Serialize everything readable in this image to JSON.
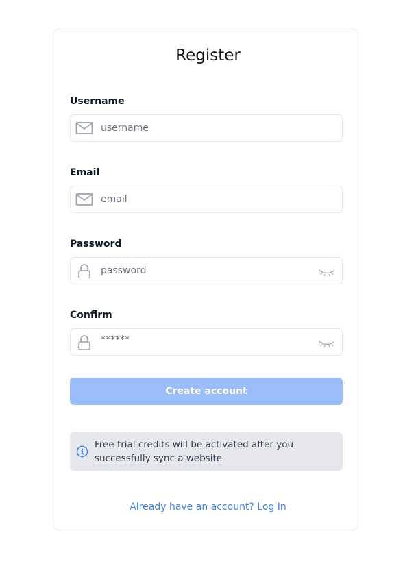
{
  "form": {
    "title": "Register",
    "username": {
      "label": "Username",
      "placeholder": "username",
      "value": "",
      "icon": "mail-icon"
    },
    "email": {
      "label": "Email",
      "placeholder": "email",
      "value": "",
      "icon": "mail-icon"
    },
    "password": {
      "label": "Password",
      "placeholder": "password",
      "value": "",
      "icon": "lock-icon",
      "toggle_icon": "eye-closed-icon"
    },
    "confirm": {
      "label": "Confirm",
      "placeholder": "******",
      "value": "",
      "icon": "lock-icon",
      "toggle_icon": "eye-closed-icon"
    },
    "submit_label": "Create account",
    "notice": {
      "icon": "info-icon",
      "text": "Free trial credits will be activated after you successfully sync a website"
    },
    "login_link": "Already have an account? Log In"
  },
  "colors": {
    "primary_disabled": "#9bbdfb",
    "link": "#3b82f6",
    "notice_bg": "#e5e7eb"
  }
}
